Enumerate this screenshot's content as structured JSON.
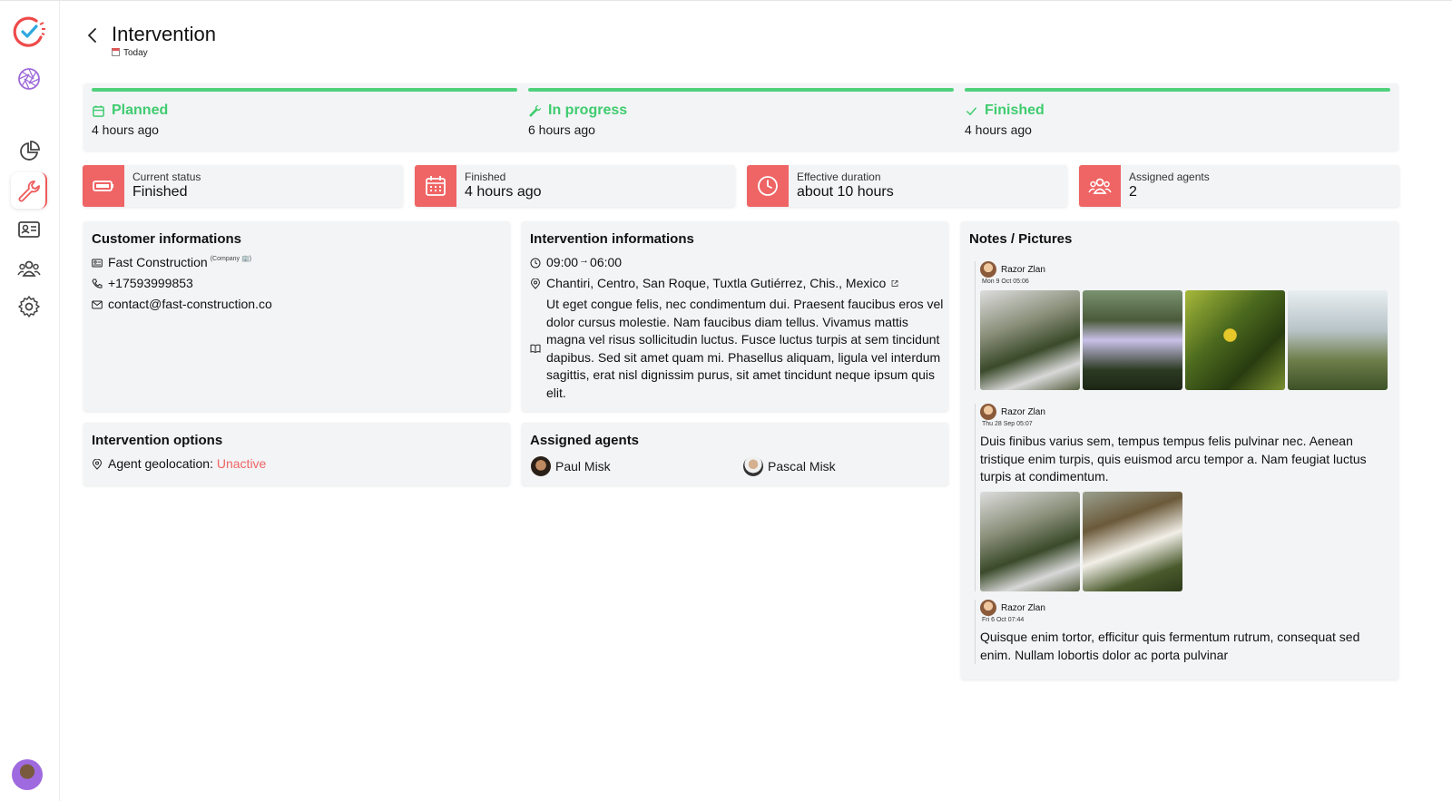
{
  "colors": {
    "accent_red": "#ef6464",
    "success_green": "#3fcc6f"
  },
  "header": {
    "title": "Intervention",
    "subtitle": "Today"
  },
  "timeline": [
    {
      "label": "Planned",
      "time": "4 hours ago",
      "icon": "calendar-icon"
    },
    {
      "label": "In progress",
      "time": "6 hours ago",
      "icon": "wrench-icon"
    },
    {
      "label": "Finished",
      "time": "4 hours ago",
      "icon": "check-icon"
    }
  ],
  "stats": [
    {
      "label": "Current status",
      "value": "Finished",
      "icon": "battery-icon"
    },
    {
      "label": "Finished",
      "value": "4 hours ago",
      "icon": "calendar-icon"
    },
    {
      "label": "Effective duration",
      "value": "about 10 hours",
      "icon": "clock-icon"
    },
    {
      "label": "Assigned agents",
      "value": "2",
      "icon": "users-icon"
    }
  ],
  "customer": {
    "title": "Customer informations",
    "company": "Fast Construction",
    "company_tag": "(Company 🏢)",
    "phone": "+17593999853",
    "email": "contact@fast-construction.co"
  },
  "intervention": {
    "title": "Intervention informations",
    "time_start": "09:00",
    "time_end": "06:00",
    "address": "Chantiri, Centro, San Roque, Tuxtla Gutiérrez, Chis., Mexico",
    "description": "Ut eget congue felis, nec condimentum dui. Praesent faucibus eros vel dolor cursus molestie. Nam faucibus diam tellus. Vivamus mattis magna vel risus sollicitudin luctus. Fusce luctus turpis at sem tincidunt dapibus. Sed sit amet quam mi. Phasellus aliquam, ligula vel interdum sagittis, erat nisl dignissim purus, sit amet tincidunt neque ipsum quis elit."
  },
  "options": {
    "title": "Intervention options",
    "geolocation_label": "Agent geolocation:",
    "geolocation_value": "Unactive"
  },
  "agents": {
    "title": "Assigned agents",
    "list": [
      "Paul Misk",
      "Pascal Misk"
    ]
  },
  "notes": {
    "title": "Notes / Pictures",
    "items": [
      {
        "author": "Razor Zlan",
        "date": "Mon 9 Oct 05:06",
        "text": ""
      },
      {
        "author": "Razor Zlan",
        "date": "Thu 28 Sep 05:07",
        "text": "Duis finibus varius sem, tempus tempus felis pulvinar nec. Aenean tristique enim turpis, quis euismod arcu tempor a. Nam feugiat luctus turpis at condimentum."
      },
      {
        "author": "Razor Zlan",
        "date": "Fri 6 Oct 07:44",
        "text": "Quisque enim tortor, efficitur quis fermentum rutrum, consequat sed enim. Nullam lobortis dolor ac porta pulvinar"
      }
    ]
  }
}
